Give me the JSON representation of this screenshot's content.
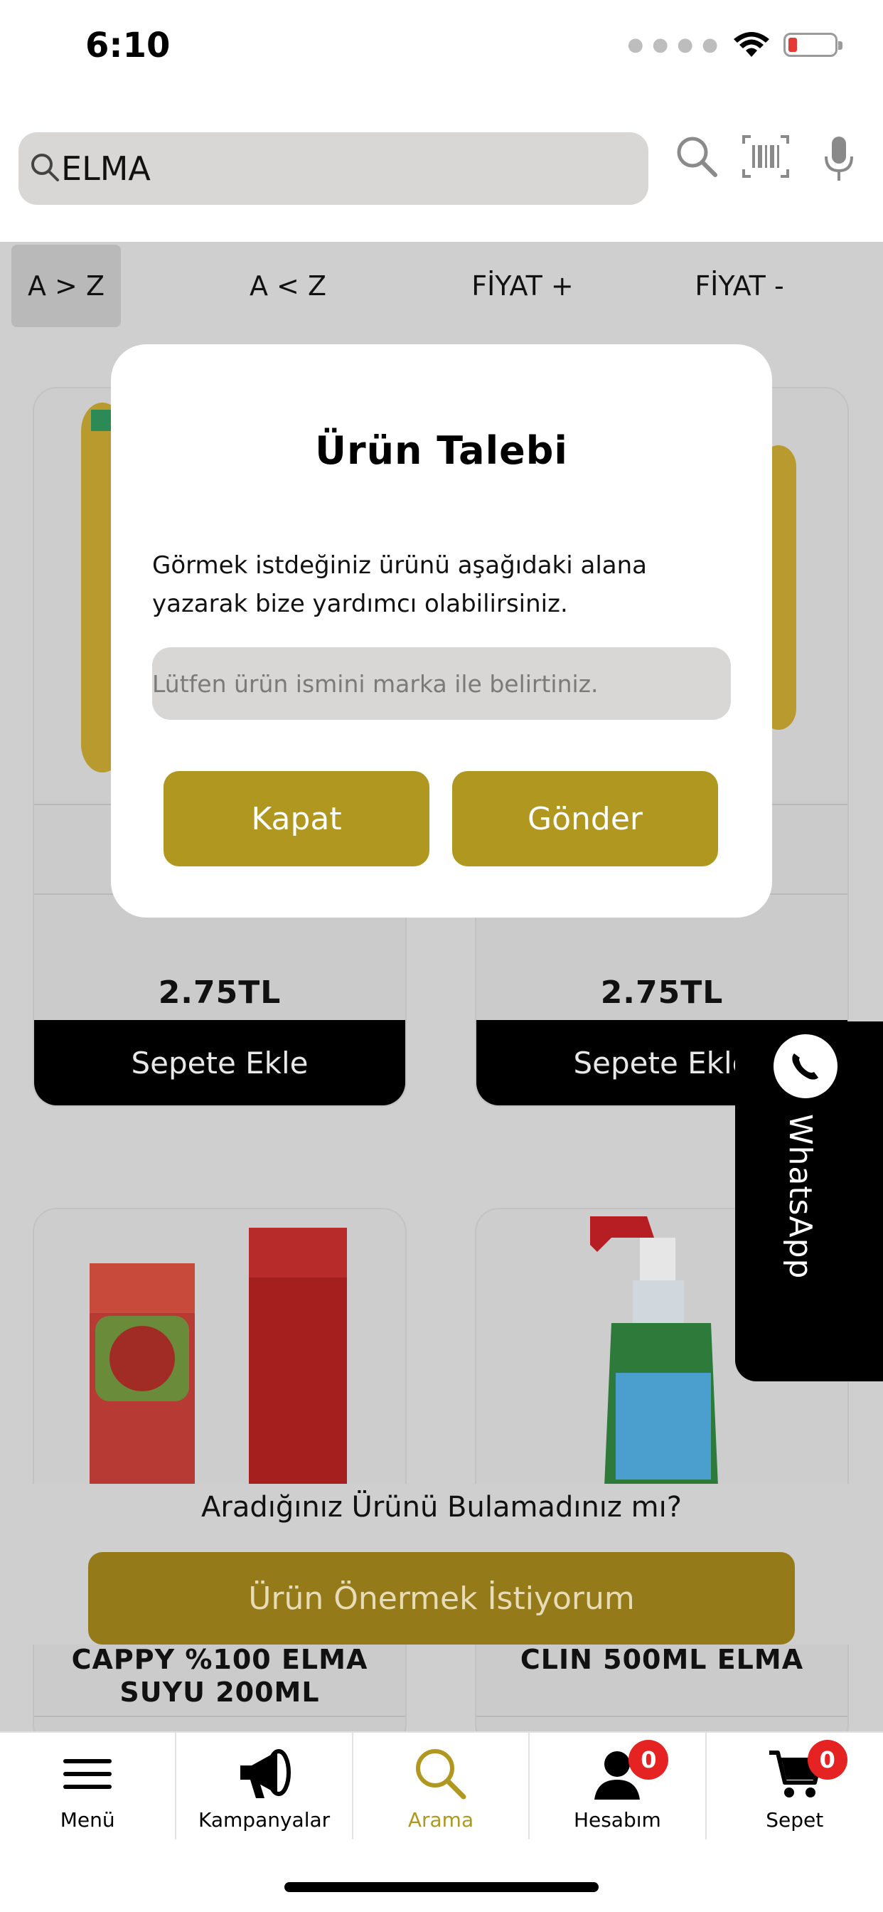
{
  "status_bar": {
    "time": "6:10"
  },
  "search": {
    "value": "ELMA"
  },
  "sort_tabs": [
    "A > Z",
    "A < Z",
    "FİYAT +",
    "FİYAT -"
  ],
  "products": [
    {
      "price": "2.75TL",
      "add_label": "Sepete Ekle"
    },
    {
      "price": "2.75TL",
      "add_label": "Sepete Ekle"
    },
    {
      "name": "CAPPY %100 ELMA SUYU 200ML"
    },
    {
      "name": "CLIN 500ML ELMA"
    }
  ],
  "whatsapp": {
    "label": "WhatsApp"
  },
  "not_found": {
    "question": "Aradığınız Ürünü Bulamadınız mı?",
    "suggest_button": "Ürün Önermek İstiyorum"
  },
  "modal": {
    "title": "Ürün Talebi",
    "description": "Görmek istdeğiniz ürünü aşağıdaki alana yazarak bize yardımcı olabilirsiniz.",
    "input_placeholder": "Lütfen ürün ismini marka ile belirtiniz.",
    "close_button": "Kapat",
    "send_button": "Gönder"
  },
  "tabbar": {
    "items": [
      {
        "label": "Menü",
        "icon": "menu-icon"
      },
      {
        "label": "Kampanyalar",
        "icon": "megaphone-icon"
      },
      {
        "label": "Arama",
        "icon": "search-icon"
      },
      {
        "label": "Hesabım",
        "icon": "user-icon",
        "badge": "0"
      },
      {
        "label": "Sepet",
        "icon": "cart-icon",
        "badge": "0"
      }
    ],
    "active": "Arama"
  },
  "colors": {
    "accent": "#b0971f",
    "suggest_button": "#957a1a",
    "badge": "#e62323",
    "overlay_gray": "#cfcfcf"
  }
}
